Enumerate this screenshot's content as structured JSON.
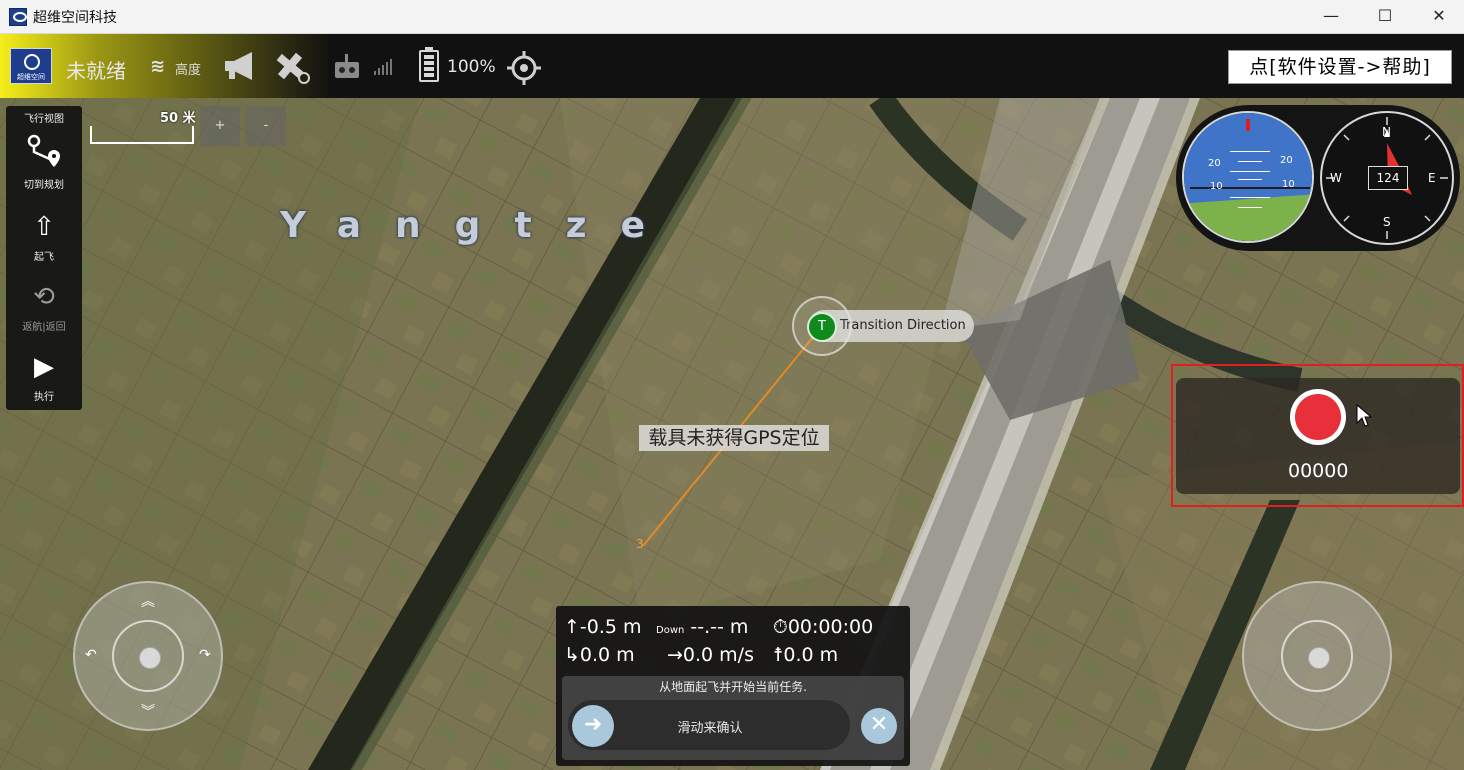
{
  "window": {
    "title": "超维空间科技",
    "minimize": "—",
    "maximize": "☐",
    "close": "✕"
  },
  "toolbar": {
    "logo_text": "超维空间",
    "status": "未就绪",
    "altitude_icon": "≋",
    "altitude_label": "高度",
    "battery": "100%",
    "help_hint": "点[软件设置->帮助]",
    "icons": [
      "megaphone-icon",
      "satellite-icon",
      "remote-controller-icon",
      "signal-bars-icon",
      "battery-icon",
      "crosshair-icon"
    ]
  },
  "left_toolbar": {
    "title": "飞行视图",
    "items": [
      {
        "label": "切到规划",
        "icon": "route-plan-icon"
      },
      {
        "label": "起飞",
        "icon": "takeoff-icon"
      },
      {
        "label": "返航|返回",
        "icon": "return-home-icon"
      },
      {
        "label": "执行",
        "icon": "play-icon"
      }
    ]
  },
  "map": {
    "scale": "50 米",
    "zoom_in": "+",
    "zoom_out": "-",
    "river_label": "Yangtze",
    "waypoint_label": "Transition Direction",
    "waypoint_marker": "T",
    "waypoint_3": "3",
    "gps_message": "载具未获得GPS定位"
  },
  "instruments": {
    "attitude": {
      "ticks": [
        "20",
        "20",
        "10",
        "10"
      ]
    },
    "compass": {
      "n": "N",
      "s": "S",
      "e": "E",
      "w": "W",
      "heading": "124"
    }
  },
  "record": {
    "time": "00000",
    "record_color": "#e8303a"
  },
  "telemetry": {
    "altitude": "-0.5 m",
    "down_label": "Down",
    "down_value": "--.-- m",
    "flight_time": "00:00:00",
    "distance": "0.0 m",
    "speed": "0.0 m/s",
    "home_distance": "0.0 m"
  },
  "mission": {
    "message": "从地面起飞并开始当前任务.",
    "slider_text": "滑动来确认",
    "slider_icon": "➜",
    "cancel_icon": "✕"
  },
  "colors": {
    "accent_red": "#e21e1e",
    "waypoint_green": "#0f8a1d",
    "path_orange": "#e08a2a",
    "slider_blue": "#a9c8dc"
  }
}
